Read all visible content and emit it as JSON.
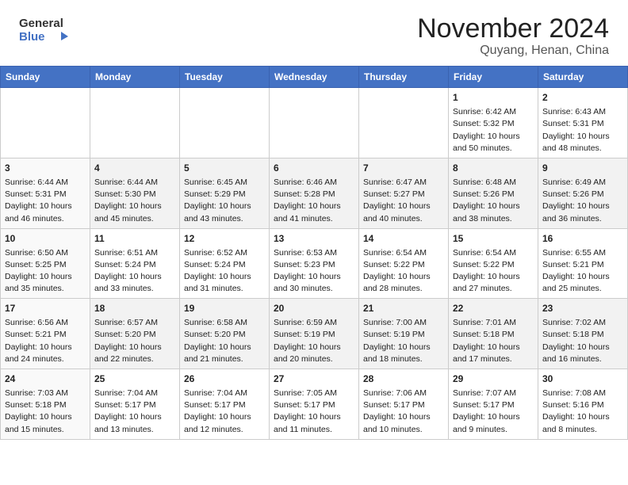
{
  "header": {
    "logo_line1": "General",
    "logo_line2": "Blue",
    "month_title": "November 2024",
    "subtitle": "Quyang, Henan, China"
  },
  "days_of_week": [
    "Sunday",
    "Monday",
    "Tuesday",
    "Wednesday",
    "Thursday",
    "Friday",
    "Saturday"
  ],
  "weeks": [
    [
      {
        "num": "",
        "content": ""
      },
      {
        "num": "",
        "content": ""
      },
      {
        "num": "",
        "content": ""
      },
      {
        "num": "",
        "content": ""
      },
      {
        "num": "",
        "content": ""
      },
      {
        "num": "1",
        "content": "Sunrise: 6:42 AM\nSunset: 5:32 PM\nDaylight: 10 hours\nand 50 minutes."
      },
      {
        "num": "2",
        "content": "Sunrise: 6:43 AM\nSunset: 5:31 PM\nDaylight: 10 hours\nand 48 minutes."
      }
    ],
    [
      {
        "num": "3",
        "content": "Sunrise: 6:44 AM\nSunset: 5:31 PM\nDaylight: 10 hours\nand 46 minutes."
      },
      {
        "num": "4",
        "content": "Sunrise: 6:44 AM\nSunset: 5:30 PM\nDaylight: 10 hours\nand 45 minutes."
      },
      {
        "num": "5",
        "content": "Sunrise: 6:45 AM\nSunset: 5:29 PM\nDaylight: 10 hours\nand 43 minutes."
      },
      {
        "num": "6",
        "content": "Sunrise: 6:46 AM\nSunset: 5:28 PM\nDaylight: 10 hours\nand 41 minutes."
      },
      {
        "num": "7",
        "content": "Sunrise: 6:47 AM\nSunset: 5:27 PM\nDaylight: 10 hours\nand 40 minutes."
      },
      {
        "num": "8",
        "content": "Sunrise: 6:48 AM\nSunset: 5:26 PM\nDaylight: 10 hours\nand 38 minutes."
      },
      {
        "num": "9",
        "content": "Sunrise: 6:49 AM\nSunset: 5:26 PM\nDaylight: 10 hours\nand 36 minutes."
      }
    ],
    [
      {
        "num": "10",
        "content": "Sunrise: 6:50 AM\nSunset: 5:25 PM\nDaylight: 10 hours\nand 35 minutes."
      },
      {
        "num": "11",
        "content": "Sunrise: 6:51 AM\nSunset: 5:24 PM\nDaylight: 10 hours\nand 33 minutes."
      },
      {
        "num": "12",
        "content": "Sunrise: 6:52 AM\nSunset: 5:24 PM\nDaylight: 10 hours\nand 31 minutes."
      },
      {
        "num": "13",
        "content": "Sunrise: 6:53 AM\nSunset: 5:23 PM\nDaylight: 10 hours\nand 30 minutes."
      },
      {
        "num": "14",
        "content": "Sunrise: 6:54 AM\nSunset: 5:22 PM\nDaylight: 10 hours\nand 28 minutes."
      },
      {
        "num": "15",
        "content": "Sunrise: 6:54 AM\nSunset: 5:22 PM\nDaylight: 10 hours\nand 27 minutes."
      },
      {
        "num": "16",
        "content": "Sunrise: 6:55 AM\nSunset: 5:21 PM\nDaylight: 10 hours\nand 25 minutes."
      }
    ],
    [
      {
        "num": "17",
        "content": "Sunrise: 6:56 AM\nSunset: 5:21 PM\nDaylight: 10 hours\nand 24 minutes."
      },
      {
        "num": "18",
        "content": "Sunrise: 6:57 AM\nSunset: 5:20 PM\nDaylight: 10 hours\nand 22 minutes."
      },
      {
        "num": "19",
        "content": "Sunrise: 6:58 AM\nSunset: 5:20 PM\nDaylight: 10 hours\nand 21 minutes."
      },
      {
        "num": "20",
        "content": "Sunrise: 6:59 AM\nSunset: 5:19 PM\nDaylight: 10 hours\nand 20 minutes."
      },
      {
        "num": "21",
        "content": "Sunrise: 7:00 AM\nSunset: 5:19 PM\nDaylight: 10 hours\nand 18 minutes."
      },
      {
        "num": "22",
        "content": "Sunrise: 7:01 AM\nSunset: 5:18 PM\nDaylight: 10 hours\nand 17 minutes."
      },
      {
        "num": "23",
        "content": "Sunrise: 7:02 AM\nSunset: 5:18 PM\nDaylight: 10 hours\nand 16 minutes."
      }
    ],
    [
      {
        "num": "24",
        "content": "Sunrise: 7:03 AM\nSunset: 5:18 PM\nDaylight: 10 hours\nand 15 minutes."
      },
      {
        "num": "25",
        "content": "Sunrise: 7:04 AM\nSunset: 5:17 PM\nDaylight: 10 hours\nand 13 minutes."
      },
      {
        "num": "26",
        "content": "Sunrise: 7:04 AM\nSunset: 5:17 PM\nDaylight: 10 hours\nand 12 minutes."
      },
      {
        "num": "27",
        "content": "Sunrise: 7:05 AM\nSunset: 5:17 PM\nDaylight: 10 hours\nand 11 minutes."
      },
      {
        "num": "28",
        "content": "Sunrise: 7:06 AM\nSunset: 5:17 PM\nDaylight: 10 hours\nand 10 minutes."
      },
      {
        "num": "29",
        "content": "Sunrise: 7:07 AM\nSunset: 5:17 PM\nDaylight: 10 hours\nand 9 minutes."
      },
      {
        "num": "30",
        "content": "Sunrise: 7:08 AM\nSunset: 5:16 PM\nDaylight: 10 hours\nand 8 minutes."
      }
    ]
  ]
}
